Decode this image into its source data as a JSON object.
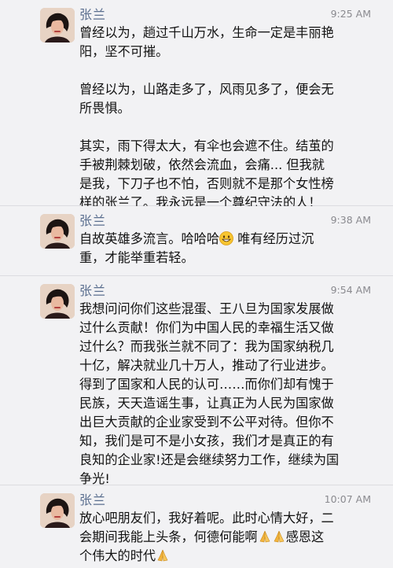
{
  "posts": [
    {
      "author": "张兰",
      "time": "9:25 AM",
      "paragraphs": [
        [
          "曾经以为，趟过千山万水，生命一定是丰丽艳",
          "阳，坚不可摧。"
        ],
        [
          "曾经以为，山路走多了，风雨见多了，便会无",
          "所畏惧。"
        ],
        [
          "其实，雨下得太大，有伞也会遮不住。结茧的",
          "手被荆棘划破，依然会流血，会痛... 但我就",
          "是我，下刀子也不怕，否则就不是那个女性榜",
          "样的张兰了。我永远是一个尊纪守法的人！"
        ]
      ]
    },
    {
      "author": "张兰",
      "time": "9:38 AM",
      "line1_a": "自故英雄多流言。哈哈哈",
      "line1_b": " 唯有经历过沉",
      "line2": "重，才能举重若轻。",
      "emoji": "grinning-face"
    },
    {
      "author": "张兰",
      "time": "9:54 AM",
      "lines": [
        "我想问问你们这些混蛋、王八旦为国家发展做",
        "过什么贡献！你们为中国人民的幸福生活又做",
        "过什么？而我张兰就不同了：我为国家纳税几",
        "十亿，解决就业几十万人，推动了行业进步。",
        "得到了国家和人民的认可……而你们却有愧于",
        "民族，天天造谣生事，让真正为人民为国家做",
        "出巨大贡献的企业家受到不公平对待。但你不",
        "知，我们是可不是小女孩，我们才是真正的有",
        "良知的企业家!还是会继续努力工作，继续为国",
        "争光!"
      ]
    },
    {
      "author": "张兰",
      "time": "10:07 AM",
      "line1": "放心吧朋友们，我好着呢。此时心情大好，二",
      "line2_a": "会期间我能上头条，何德何能啊",
      "line2_b": "感恩这",
      "line3_a": "个伟大的时代",
      "emoji": "folded-hands"
    }
  ],
  "colors": {
    "name": "#5b6f8f",
    "time": "#8a8a8f",
    "text": "#111111",
    "background": "#f2f2f4"
  }
}
